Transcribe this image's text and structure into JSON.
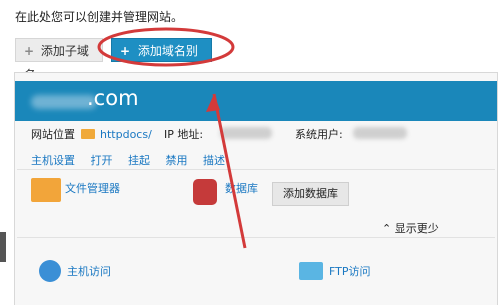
{
  "intro_text": "在此处您可以创建并管理网站。",
  "buttons": {
    "add_subdomain": "添加子域名",
    "add_alias": "添加域名别名"
  },
  "site": {
    "domain_suffix": ".com",
    "location_label": "网站位置",
    "docroot": "httpdocs/",
    "ip_label": "IP 地址:",
    "sysuser_label": "系统用户:"
  },
  "actions": [
    "主机设置",
    "打开",
    "挂起",
    "禁用",
    "描述"
  ],
  "tools": {
    "file_manager": "文件管理器",
    "database": "数据库",
    "add_database": "添加数据库",
    "show_more": "显示更少",
    "hosting_access": "主机访问",
    "ftp_access": "FTP访问"
  },
  "colors": {
    "accent": "#1e8fc3",
    "banner": "#1a87ba",
    "annotation": "#d33a3a"
  },
  "icons": {
    "plus": "plus-icon",
    "folder": "folder-icon",
    "database": "database-icon",
    "globe": "globe-icon",
    "ftp": "ftp-icon"
  }
}
